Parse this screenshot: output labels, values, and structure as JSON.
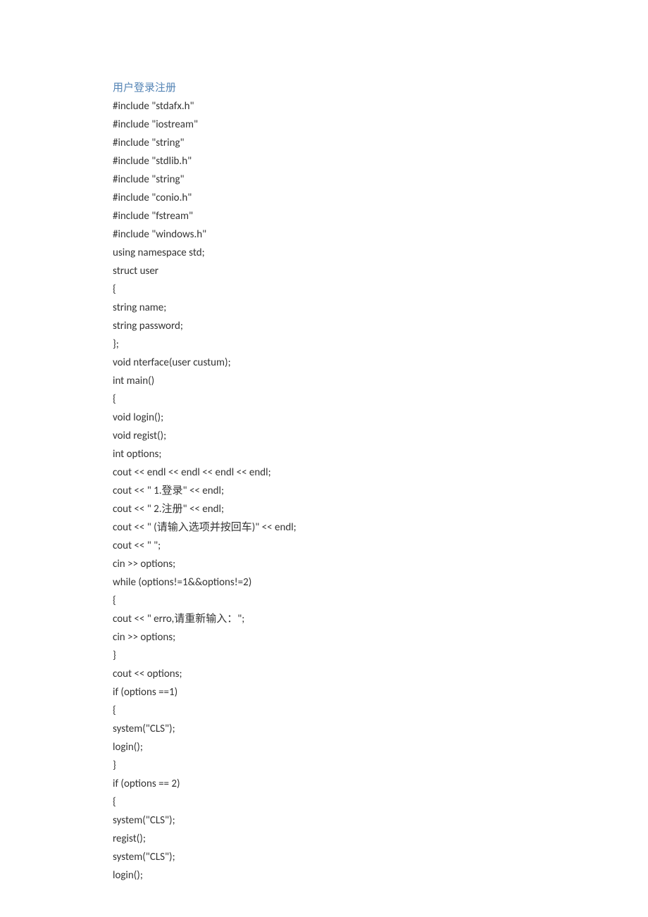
{
  "title": "用户登录注册",
  "lines": [
    "#include \"stdafx.h\"",
    "#include \"iostream\"",
    "#include \"string\"",
    "#include \"stdlib.h\"",
    "#include \"string\"",
    "#include \"conio.h\"",
    "#include \"fstream\"",
    "#include \"windows.h\"",
    "using namespace std;",
    "struct user",
    "{",
    "string name;",
    "string password;",
    "};",
    "void nterface(user custum);",
    "int main()",
    "{",
    "void login();",
    "void regist();",
    "int options;",
    "cout << endl << endl << endl << endl;",
    "cout << \" 1.登录\" << endl;",
    "cout << \" 2.注册\" << endl;",
    "cout << \" (请输入选项并按回车)\" << endl;",
    "cout << \" \";",
    "cin >> options;",
    "while (options!=1&&options!=2)",
    "{",
    "cout << \" erro,请重新输入：\";",
    "cin >> options;",
    "}",
    "cout << options;",
    "if (options ==1)",
    "{",
    "system(\"CLS\");",
    "login();",
    "}",
    "if (options == 2)",
    "{",
    "system(\"CLS\");",
    "regist();",
    "system(\"CLS\");",
    "login();"
  ]
}
